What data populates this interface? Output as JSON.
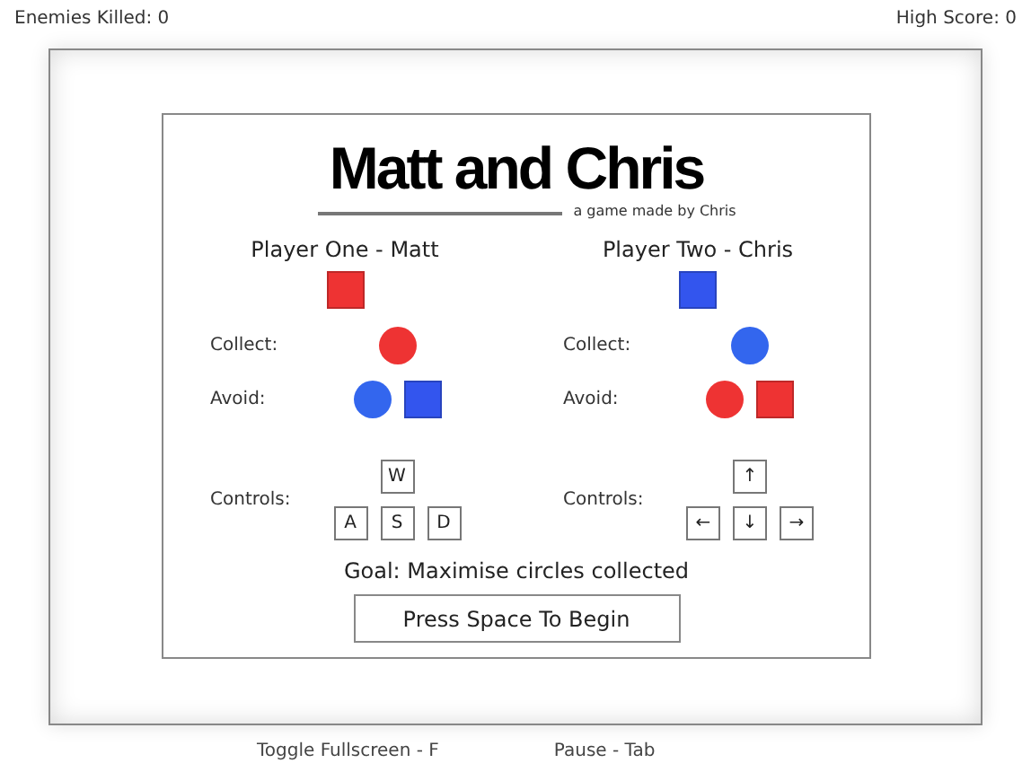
{
  "stats": {
    "enemies_killed": "Enemies Killed: 0",
    "high_score": "High Score: 0"
  },
  "title": "Matt and Chris",
  "subtitle": "a game made by Chris",
  "players": [
    {
      "name": "Player One - Matt",
      "avatar": {
        "kind": "square",
        "color": "#ee3333"
      },
      "collect_label": "Collect:",
      "collect": [
        {
          "kind": "circle",
          "color": "#ee3333"
        }
      ],
      "avoid_label": "Avoid:",
      "avoid": [
        {
          "kind": "circle",
          "color": "#3366ee"
        },
        {
          "kind": "square",
          "color": "#3355ee"
        }
      ],
      "controls_label": "Controls:",
      "keys": [
        [
          "W"
        ],
        [
          "A",
          "S",
          "D"
        ]
      ]
    },
    {
      "name": "Player Two - Chris",
      "avatar": {
        "kind": "square",
        "color": "#3355ee"
      },
      "collect_label": "Collect:",
      "collect": [
        {
          "kind": "circle",
          "color": "#3366ee"
        }
      ],
      "avoid_label": "Avoid:",
      "avoid": [
        {
          "kind": "circle",
          "color": "#ee3333"
        },
        {
          "kind": "square",
          "color": "#ee3333"
        }
      ],
      "controls_label": "Controls:",
      "keys": [
        [
          "↑"
        ],
        [
          "←",
          "↓",
          "→"
        ]
      ]
    }
  ],
  "goal": "Goal: Maximise circles collected",
  "start_button": "Press Space To Begin",
  "footer": [
    "Toggle Fullscreen - F",
    "Pause - Tab"
  ]
}
